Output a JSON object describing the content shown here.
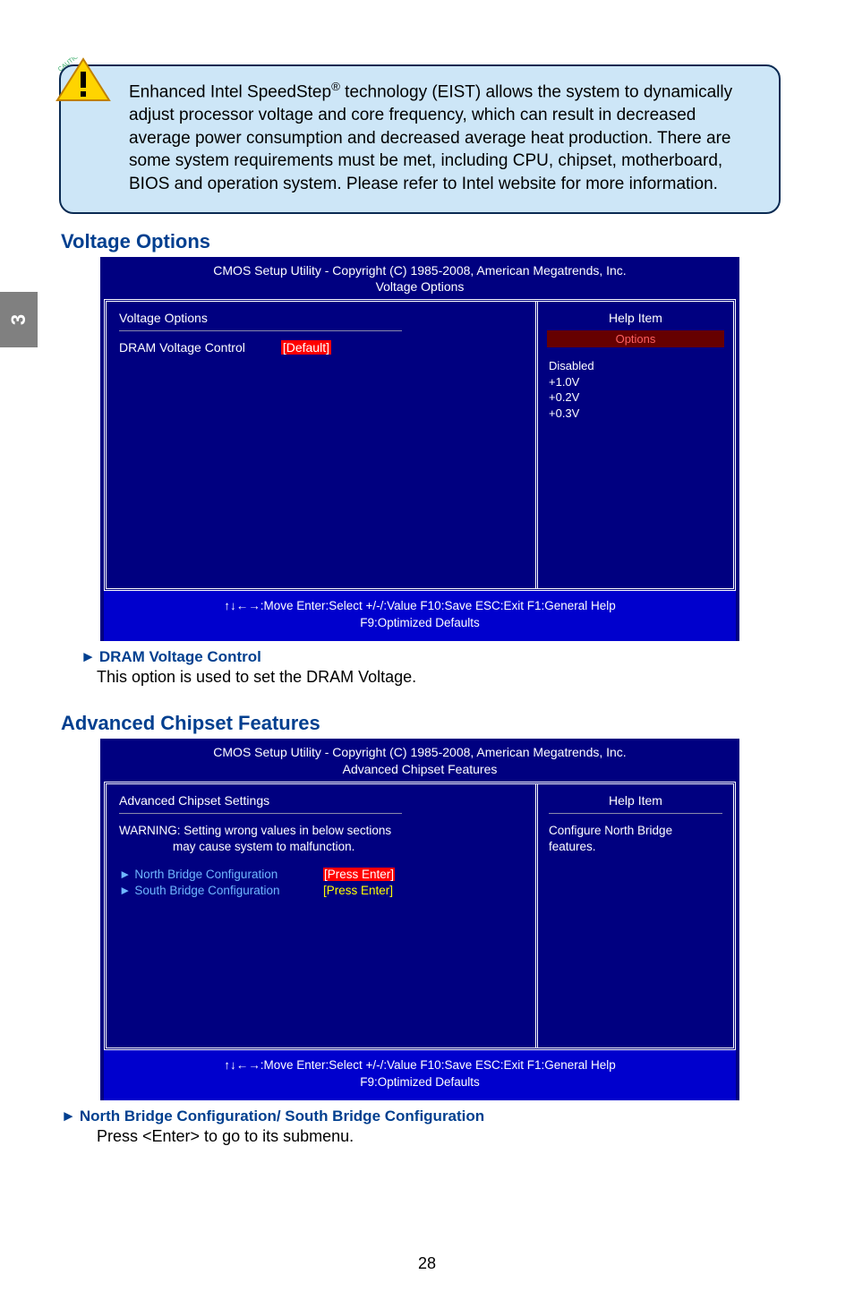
{
  "tab_number": "3",
  "caution": {
    "text_before_reg": "Enhanced Intel SpeedStep",
    "reg": "®",
    "text_after_reg": " technology (EIST) allows the system to dynamically adjust processor voltage and core frequency, which can result in decreased average power consumption and decreased average heat production.  There are some system requirements must be met, including CPU, chipset, motherboard, BIOS and operation system. Please refer to Intel website for more information."
  },
  "section1_title": "Voltage Options",
  "bios1": {
    "header_line1": "CMOS Setup Utility - Copyright (C) 1985-2008, American Megatrends, Inc.",
    "header_line2": "Voltage Options",
    "left_title": "Voltage Options",
    "row_label": "DRAM Voltage Control",
    "row_value": "[Default]",
    "help_title": "Help Item",
    "options_label": "Options",
    "options": [
      "Disabled",
      "+1.0V",
      "+0.2V",
      "+0.3V"
    ],
    "footer_line1": "↑↓←→:Move   Enter:Select     +/-/:Value     F10:Save     ESC:Exit     F1:General Help",
    "footer_line2": "F9:Optimized Defaults"
  },
  "item1": {
    "title": "DRAM Voltage Control",
    "desc": "This option is used to set the DRAM Voltage."
  },
  "section2_title": "Advanced Chipset Features",
  "bios2": {
    "header_line1": "CMOS Setup Utility - Copyright (C) 1985-2008, American Megatrends, Inc.",
    "header_line2": "Advanced Chipset Features",
    "left_title": "Advanced Chipset Settings",
    "warning_l1": "WARNING: Setting wrong values in below sections",
    "warning_l2": "may cause system to malfunction.",
    "menu1_label": "North Bridge Configuration",
    "menu1_val": "[Press Enter]",
    "menu2_label": "South Bridge Configuration",
    "menu2_val": "[Press Enter]",
    "help_title": "Help Item",
    "help_text": "Configure North Bridge features.",
    "footer_line1": "↑↓←→:Move   Enter:Select     +/-/:Value   F10:Save   ESC:Exit    F1:General Help",
    "footer_line2": "F9:Optimized Defaults"
  },
  "item2": {
    "title": "North Bridge Configuration/ South Bridge Configuration",
    "desc": "Press <Enter> to go to its submenu."
  },
  "page_number": "28"
}
